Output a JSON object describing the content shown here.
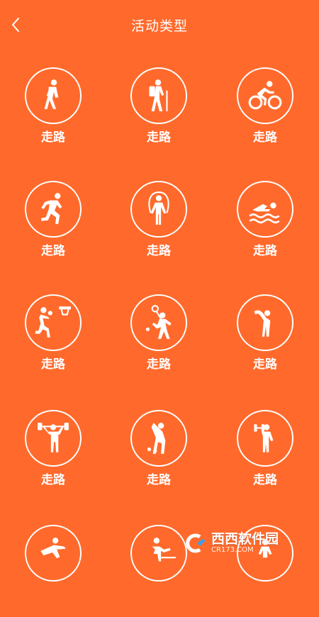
{
  "header": {
    "title": "活动类型"
  },
  "colors": {
    "background": "#FF6A2C",
    "foreground": "#FFFFFF"
  },
  "activities": [
    {
      "label": "走路",
      "icon": "walking-icon"
    },
    {
      "label": "走路",
      "icon": "hiking-icon"
    },
    {
      "label": "走路",
      "icon": "cycling-icon"
    },
    {
      "label": "走路",
      "icon": "running-icon"
    },
    {
      "label": "走路",
      "icon": "jump-rope-icon"
    },
    {
      "label": "走路",
      "icon": "swimming-icon"
    },
    {
      "label": "走路",
      "icon": "basketball-icon"
    },
    {
      "label": "走路",
      "icon": "badminton-icon"
    },
    {
      "label": "走路",
      "icon": "stretching-icon"
    },
    {
      "label": "走路",
      "icon": "weightlifting-icon"
    },
    {
      "label": "走路",
      "icon": "golf-icon"
    },
    {
      "label": "走路",
      "icon": "dumbbell-icon"
    },
    {
      "icon": "dance-icon"
    },
    {
      "icon": "table-tennis-icon"
    },
    {
      "icon": "sport-icon"
    }
  ],
  "watermark": {
    "brand": "西西软件园",
    "site": "CR173.COM"
  }
}
